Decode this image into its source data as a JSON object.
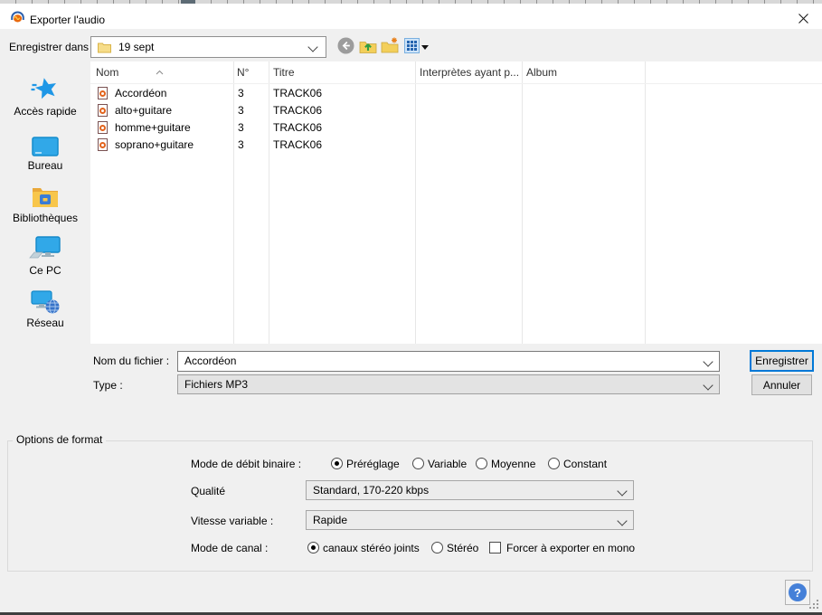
{
  "window": {
    "title": "Exporter l'audio"
  },
  "address_bar": {
    "label": "Enregistrer dans :",
    "value": "19 sept"
  },
  "sidebar": {
    "items": [
      {
        "label": "Accès rapide",
        "icon": "quick-access-star-icon"
      },
      {
        "label": "Bureau",
        "icon": "desktop-icon"
      },
      {
        "label": "Bibliothèques",
        "icon": "libraries-icon"
      },
      {
        "label": "Ce PC",
        "icon": "this-pc-icon"
      },
      {
        "label": "Réseau",
        "icon": "network-icon"
      }
    ]
  },
  "file_list": {
    "columns": {
      "name": "Nom",
      "num": "N°",
      "title": "Titre",
      "artists": "Interprètes ayant p...",
      "album": "Album"
    },
    "rows": [
      {
        "name": "Accordéon",
        "num": "3",
        "title": "TRACK06"
      },
      {
        "name": "alto+guitare",
        "num": "3",
        "title": "TRACK06"
      },
      {
        "name": "homme+guitare",
        "num": "3",
        "title": "TRACK06"
      },
      {
        "name": "soprano+guitare",
        "num": "3",
        "title": "TRACK06"
      }
    ]
  },
  "filename": {
    "label": "Nom du fichier :",
    "value": "Accordéon"
  },
  "filetype": {
    "label": "Type :",
    "value": "Fichiers MP3"
  },
  "actions": {
    "save": "Enregistrer",
    "cancel": "Annuler",
    "help": "?"
  },
  "options": {
    "group_title": "Options de format",
    "bitrate_mode": {
      "label": "Mode de débit binaire :",
      "choices": [
        {
          "label": "Préréglage",
          "selected": true
        },
        {
          "label": "Variable",
          "selected": false
        },
        {
          "label": "Moyenne",
          "selected": false
        },
        {
          "label": "Constant",
          "selected": false
        }
      ]
    },
    "quality": {
      "label": "Qualité",
      "value": "Standard, 170-220 kbps"
    },
    "variable_speed": {
      "label": "Vitesse variable :",
      "value": "Rapide"
    },
    "channel_mode": {
      "label": "Mode de canal :",
      "choices": [
        {
          "label": "canaux stéréo joints",
          "selected": true
        },
        {
          "label": "Stéréo",
          "selected": false
        }
      ],
      "mono_checkbox": {
        "label": "Forcer à exporter en mono",
        "checked": false
      }
    }
  },
  "colors": {
    "accent": "#0078d7",
    "help_blue": "#4580d8",
    "audacity_orange": "#e86a10",
    "audacity_blue": "#2b5fac"
  }
}
